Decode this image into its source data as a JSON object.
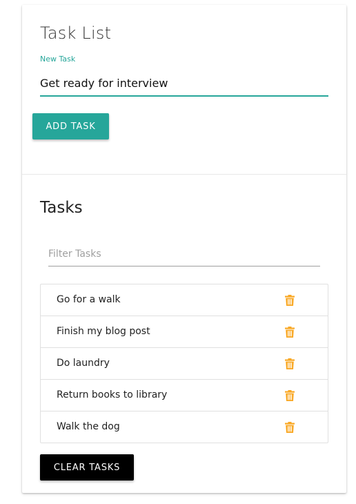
{
  "colors": {
    "accent": "#26a69a",
    "delete_icon": "#f9a825",
    "clear_button": "#000000"
  },
  "add_section": {
    "title": "Task List",
    "input_label": "New Task",
    "input_value": "Get ready for interview",
    "add_button_label": "ADD TASK"
  },
  "tasks_section": {
    "title": "Tasks",
    "filter_placeholder": "Filter Tasks",
    "items": [
      {
        "text": "Go for a walk",
        "icon": "trash-icon"
      },
      {
        "text": "Finish my blog post",
        "icon": "trash-icon"
      },
      {
        "text": "Do laundry",
        "icon": "trash-icon"
      },
      {
        "text": "Return books to library",
        "icon": "trash-icon"
      },
      {
        "text": "Walk the dog",
        "icon": "trash-icon"
      }
    ],
    "clear_button_label": "CLEAR TASKS"
  }
}
